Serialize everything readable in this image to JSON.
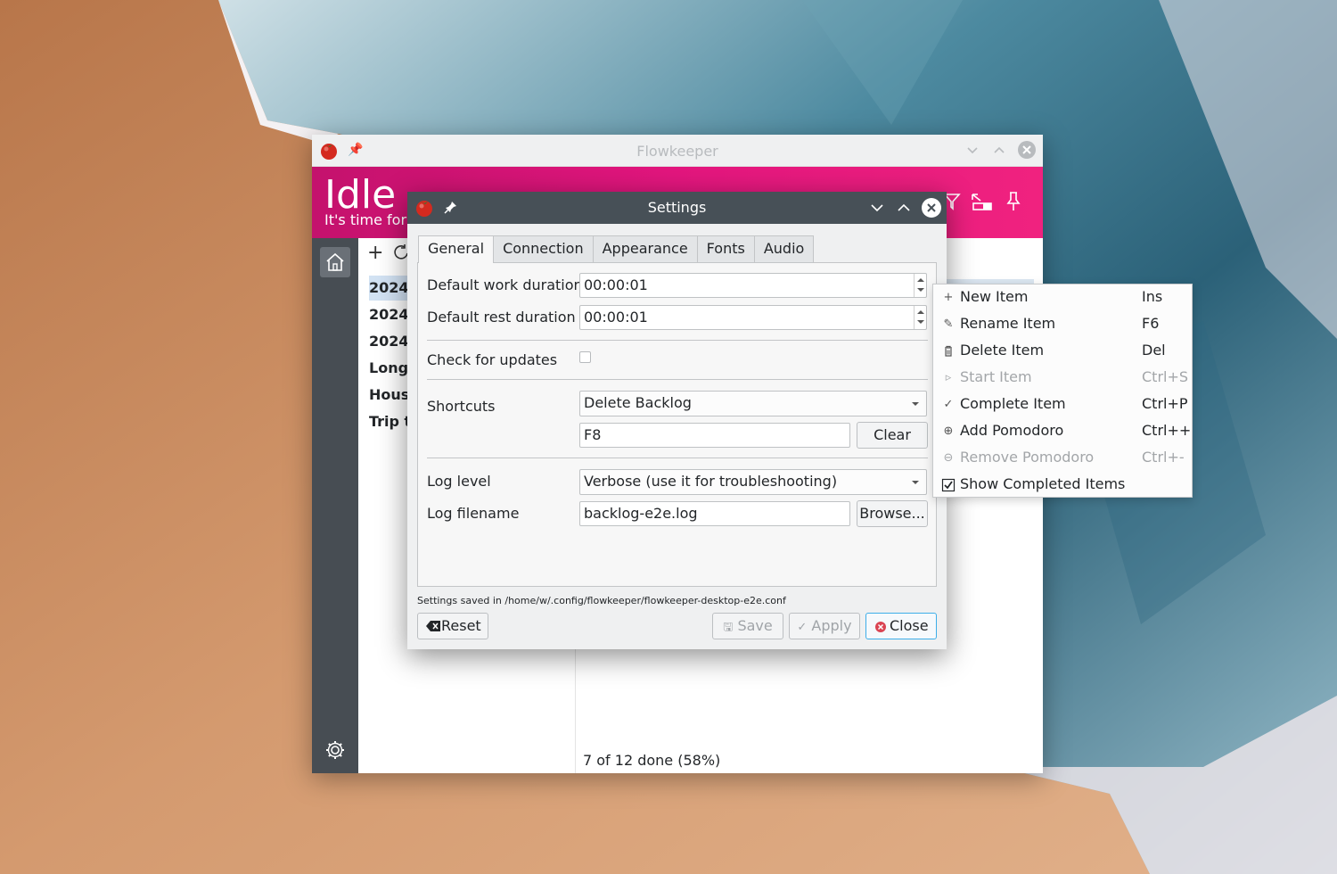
{
  "main_window": {
    "title": "Flowkeeper",
    "state": "Idle",
    "state_subtitle": "It's time for",
    "backlogs": [
      "2024-",
      "2024-",
      "2024-",
      "Long-",
      "Hous",
      "Trip t"
    ],
    "summary": "7 of 12 done (58%)",
    "accent": "#e3167e"
  },
  "settings": {
    "title": "Settings",
    "tabs": [
      "General",
      "Connection",
      "Appearance",
      "Fonts",
      "Audio"
    ],
    "work_label": "Default work duration",
    "work_value": "00:00:01",
    "rest_label": "Default rest duration",
    "rest_value": "00:00:01",
    "updates_label": "Check for updates",
    "updates_checked": false,
    "shortcuts_label": "Shortcuts",
    "shortcut_selected": "Delete Backlog",
    "shortcut_value": "F8",
    "clear_label": "Clear",
    "loglevel_label": "Log level",
    "loglevel_value": "Verbose (use it for troubleshooting)",
    "logfile_label": "Log filename",
    "logfile_value": "backlog-e2e.log",
    "browse_label": "Browse...",
    "saved_path": "Settings saved in /home/w/.config/flowkeeper/flowkeeper-desktop-e2e.conf",
    "reset_label": "Reset",
    "save_label": "Save",
    "apply_label": "Apply",
    "close_label": "Close"
  },
  "context_menu": {
    "items": [
      {
        "icon": "plus-icon",
        "label": "New Item",
        "shortcut": "Ins",
        "enabled": true
      },
      {
        "icon": "pencil-icon",
        "label": "Rename Item",
        "shortcut": "F6",
        "enabled": true
      },
      {
        "icon": "trash-icon",
        "label": "Delete Item",
        "shortcut": "Del",
        "enabled": true
      },
      {
        "icon": "play-icon",
        "label": "Start Item",
        "shortcut": "Ctrl+S",
        "enabled": false
      },
      {
        "icon": "check-icon",
        "label": "Complete Item",
        "shortcut": "Ctrl+P",
        "enabled": true
      },
      {
        "icon": "circle-plus-icon",
        "label": "Add Pomodoro",
        "shortcut": "Ctrl++",
        "enabled": true
      },
      {
        "icon": "circle-minus-icon",
        "label": "Remove Pomodoro",
        "shortcut": "Ctrl+-",
        "enabled": false
      },
      {
        "icon": "checkbox-icon",
        "label": "Show Completed Items",
        "shortcut": "",
        "enabled": true
      }
    ]
  }
}
